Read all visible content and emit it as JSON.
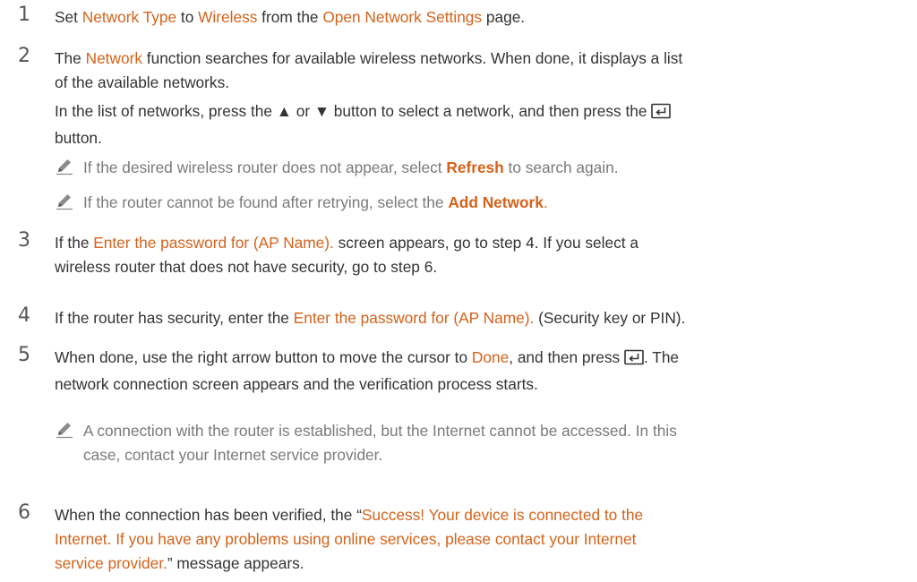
{
  "steps": [
    {
      "number": "1",
      "parts": [
        "Set ",
        "Network Type",
        " to ",
        "Wireless",
        " from the ",
        "Open Network Settings",
        " page."
      ]
    },
    {
      "number": "2",
      "line1_parts": [
        "The ",
        "Network",
        " function searches for available wireless networks. When done, it displays a list"
      ],
      "line2": "of the available networks.",
      "sub_line1": "In the list of networks, press the ▲ or ▼ button to select a network, and then press the",
      "sub_line2": "button.",
      "notes": [
        {
          "parts": [
            "If the desired wireless router does not appear, select ",
            "Refresh",
            " to search again."
          ]
        },
        {
          "parts": [
            "If the router cannot be found after retrying, select the ",
            "Add Network",
            "."
          ]
        }
      ]
    },
    {
      "number": "3",
      "line1_parts": [
        "If the ",
        "Enter the password for (AP Name).",
        " screen appears, go to step 4. If you select a"
      ],
      "line2": "wireless router that does not have security, go to step 6."
    },
    {
      "number": "4",
      "parts": [
        "If the router has security, enter the ",
        "Enter the password for (AP Name).",
        " (Security key or PIN)."
      ]
    },
    {
      "number": "5",
      "line1_parts": [
        "When done, use the right arrow button to move the cursor to ",
        "Done",
        ", and then press",
        ". The"
      ],
      "line2": "network connection screen appears and the verification process starts.",
      "note_line1": "A connection with the router is established, but the Internet cannot be accessed. In this",
      "note_line2": "case, contact your Internet service provider."
    },
    {
      "number": "6",
      "line1_parts": [
        "When the connection has been verified, the “",
        "Success! Your device is connected to the"
      ],
      "line2": "Internet. If you have any problems using online services, please contact your Internet",
      "line3_parts": [
        "service provider.",
        "” message appears."
      ]
    }
  ],
  "colors": {
    "highlight": "#d4621a",
    "body_text": "#333333",
    "note_text": "#7a7a7a",
    "step_number": "#555555"
  },
  "icons": {
    "note": "pencil-icon",
    "enter": "enter-key-icon"
  }
}
